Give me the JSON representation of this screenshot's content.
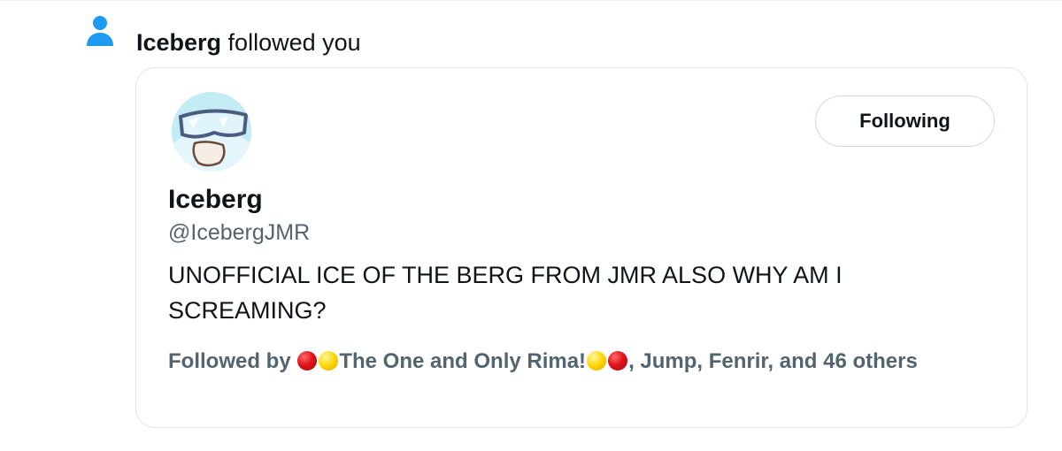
{
  "notification": {
    "icon": "person-icon",
    "actor": "Iceberg",
    "action": " followed you",
    "icon_color": "#1d9bf0"
  },
  "card": {
    "avatar": "goggles-avatar",
    "follow_button_label": "Following",
    "display_name": "Iceberg",
    "handle": "@IcebergJMR",
    "bio": "UNOFFICIAL ICE OF THE BERG FROM JMR ALSO WHY AM I SCREAMING?",
    "followed_by": {
      "prefix": "Followed by ",
      "friend_1": "The One and Only Rima!",
      "rest": ", Jump, Fenrir, and 46 others",
      "emoji_colors": [
        "#e1141b",
        "#ffd500"
      ]
    }
  }
}
